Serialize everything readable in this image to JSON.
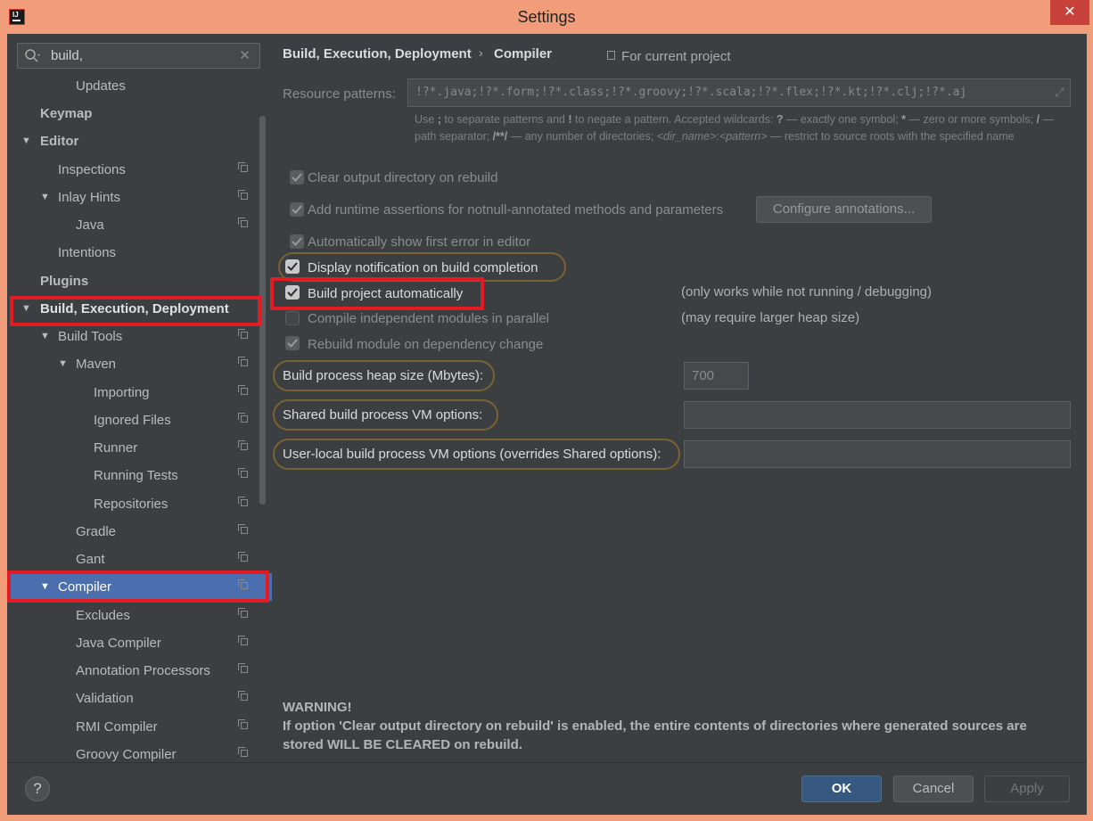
{
  "window": {
    "title": "Settings",
    "app_icon_text": "IJ",
    "close_glyph": "✕"
  },
  "search": {
    "value": "build,",
    "clear_glyph": "✕"
  },
  "tree": [
    {
      "label": "Updates"
    },
    {
      "label": "Keymap"
    },
    {
      "label": "Editor"
    },
    {
      "label": "Inspections"
    },
    {
      "label": "Inlay Hints"
    },
    {
      "label": "Java"
    },
    {
      "label": "Intentions"
    },
    {
      "label": "Plugins"
    },
    {
      "label": "Build, Execution, Deployment"
    },
    {
      "label": "Build Tools"
    },
    {
      "label": "Maven"
    },
    {
      "label": "Importing"
    },
    {
      "label": "Ignored Files"
    },
    {
      "label": "Runner"
    },
    {
      "label": "Running Tests"
    },
    {
      "label": "Repositories"
    },
    {
      "label": "Gradle"
    },
    {
      "label": "Gant"
    },
    {
      "label": "Compiler"
    },
    {
      "label": "Excludes"
    },
    {
      "label": "Java Compiler"
    },
    {
      "label": "Annotation Processors"
    },
    {
      "label": "Validation"
    },
    {
      "label": "RMI Compiler"
    },
    {
      "label": "Groovy Compiler"
    }
  ],
  "breadcrumb": {
    "parent": "Build, Execution, Deployment",
    "separator": "›",
    "current": "Compiler",
    "scope": "For current project"
  },
  "resource_patterns": {
    "label": "Resource patterns:",
    "value": "!?*.java;!?*.form;!?*.class;!?*.groovy;!?*.scala;!?*.flex;!?*.kt;!?*.clj;!?*.aj",
    "help": {
      "t1": "Use ",
      "k1": ";",
      "t2": " to separate patterns and ",
      "k2": "!",
      "t3": " to negate a pattern. Accepted wildcards: ",
      "k3": "?",
      "t4": " — exactly one symbol; ",
      "k4": "*",
      "t5": " — zero or more symbols; ",
      "k5": "/",
      "t6": " — path separator; ",
      "k6": "/**/",
      "t7": " — any number of directories; ",
      "i1": "<dir_name>",
      "t8": ":",
      "i2": "<pattern>",
      "t9": " — restrict to source roots with the specified name"
    }
  },
  "options": {
    "clear_output": {
      "label": "Clear output directory on rebuild",
      "checked": true
    },
    "runtime_assertions": {
      "label": "Add runtime assertions for notnull-annotated methods and parameters",
      "checked": true
    },
    "configure_annotations": "Configure annotations...",
    "show_first_error": {
      "label": "Automatically show first error in editor",
      "checked": true
    },
    "display_notification": {
      "label": "Display notification on build completion",
      "checked": true
    },
    "build_automatically": {
      "label": "Build project automatically",
      "checked": true,
      "note": "(only works while not running / debugging)"
    },
    "compile_parallel": {
      "label": "Compile independent modules in parallel",
      "checked": false,
      "note": "(may require larger heap size)"
    },
    "rebuild_dependency": {
      "label": "Rebuild module on dependency change",
      "checked": true
    }
  },
  "heap": {
    "label": "Build process heap size (Mbytes):",
    "value": "700"
  },
  "shared_vm": {
    "label": "Shared build process VM options:",
    "value": ""
  },
  "user_vm": {
    "label": "User-local build process VM options (overrides Shared options):",
    "value": ""
  },
  "warning": {
    "title": "WARNING!",
    "text": "If option 'Clear output directory on rebuild' is enabled, the entire contents of directories where generated sources are stored WILL BE CLEARED on rebuild."
  },
  "buttons": {
    "help": "?",
    "ok": "OK",
    "cancel": "Cancel",
    "apply": "Apply"
  }
}
